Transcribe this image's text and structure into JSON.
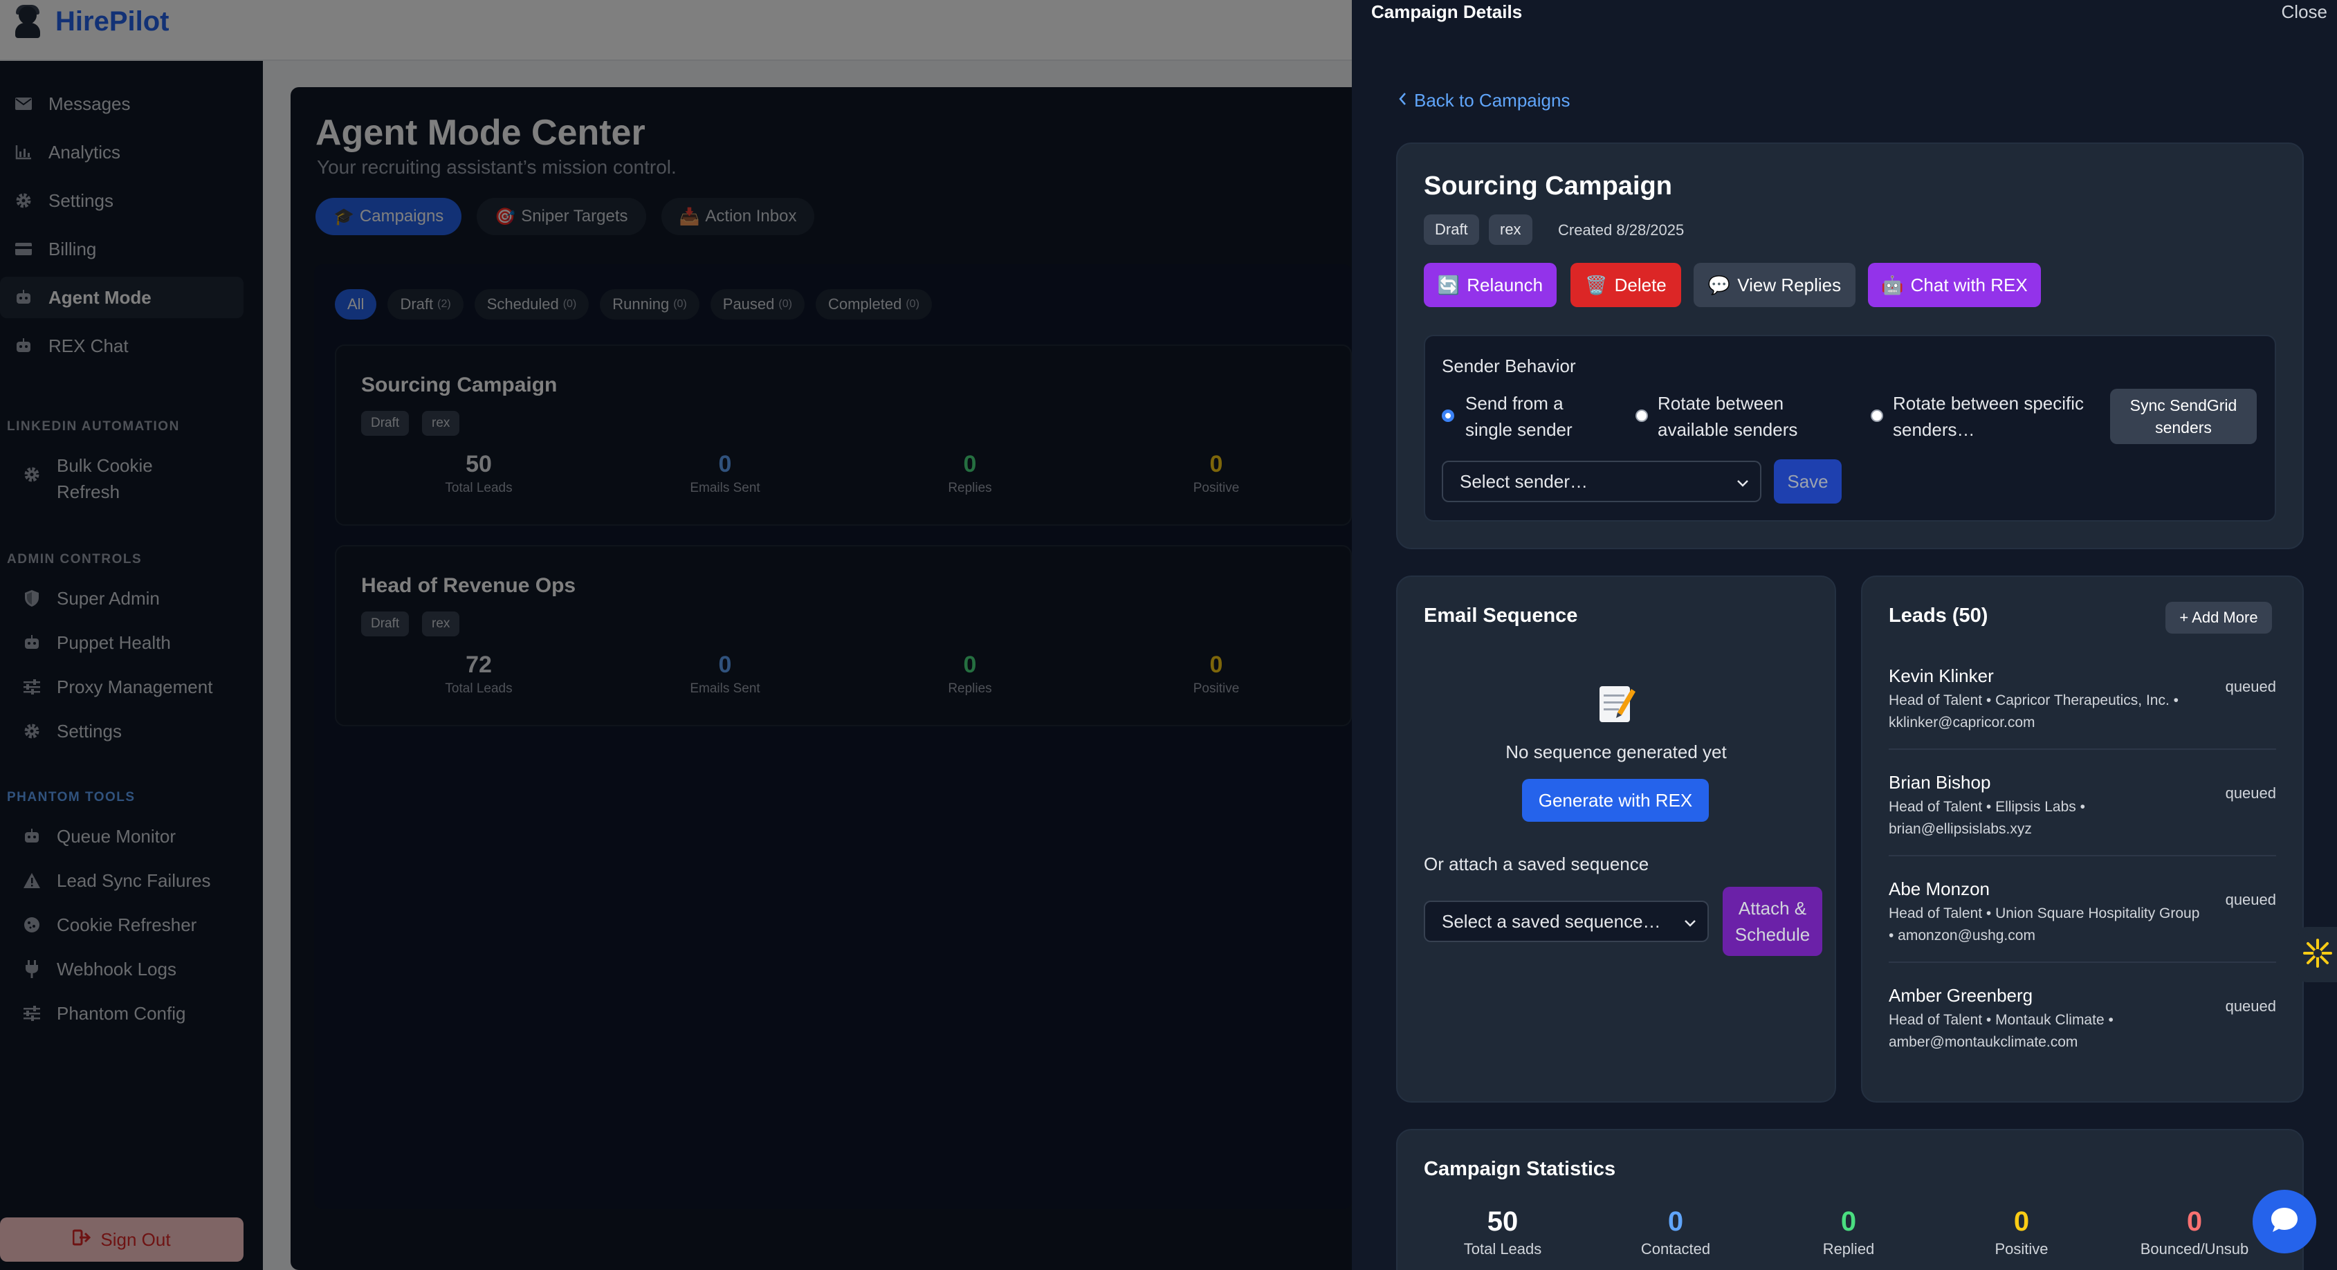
{
  "app": {
    "name": "HirePilot"
  },
  "sidebar": {
    "items": [
      {
        "label": "Messages",
        "icon": "envelope-icon"
      },
      {
        "label": "Analytics",
        "icon": "chart-icon"
      },
      {
        "label": "Settings",
        "icon": "gear-icon"
      },
      {
        "label": "Billing",
        "icon": "credit-card-icon"
      },
      {
        "label": "Agent Mode",
        "icon": "robot-icon"
      },
      {
        "label": "REX Chat",
        "icon": "robot-icon"
      }
    ],
    "linkedin_heading": "LINKEDIN AUTOMATION",
    "linkedin_items": [
      {
        "label_line1": "Bulk Cookie",
        "label_line2": "Refresh",
        "icon": "gear-icon"
      }
    ],
    "admin_heading": "ADMIN CONTROLS",
    "admin_items": [
      {
        "label": "Super Admin",
        "icon": "shield-icon"
      },
      {
        "label": "Puppet Health",
        "icon": "robot-icon"
      },
      {
        "label": "Proxy Management",
        "icon": "sliders-icon"
      },
      {
        "label": "Settings",
        "icon": "gear-icon"
      }
    ],
    "phantom_heading": "PHANTOM TOOLS",
    "phantom_items": [
      {
        "label": "Queue Monitor",
        "icon": "robot-icon"
      },
      {
        "label": "Lead Sync Failures",
        "icon": "warning-icon"
      },
      {
        "label": "Cookie Refresher",
        "icon": "cookie-icon"
      },
      {
        "label": "Webhook Logs",
        "icon": "plug-icon"
      },
      {
        "label": "Phantom Config",
        "icon": "sliders-icon"
      }
    ],
    "signout": "Sign Out"
  },
  "main": {
    "title": "Agent Mode Center",
    "subtitle": "Your recruiting assistant’s mission control.",
    "tabs": [
      {
        "label": "Campaigns",
        "emoji": "🎓"
      },
      {
        "label": "Sniper Targets",
        "emoji": "🎯"
      },
      {
        "label": "Action Inbox",
        "emoji": "📥"
      }
    ],
    "filters": [
      {
        "label": "All",
        "count": ""
      },
      {
        "label": "Draft",
        "count": "(2)"
      },
      {
        "label": "Scheduled",
        "count": "(0)"
      },
      {
        "label": "Running",
        "count": "(0)"
      },
      {
        "label": "Paused",
        "count": "(0)"
      },
      {
        "label": "Completed",
        "count": "(0)"
      }
    ],
    "campaigns": [
      {
        "name": "Sourcing Campaign",
        "status": "Draft",
        "owner": "rex",
        "stats": [
          {
            "num": "50",
            "label": "Total Leads"
          },
          {
            "num": "0",
            "label": "Emails Sent"
          },
          {
            "num": "0",
            "label": "Replies"
          },
          {
            "num": "0",
            "label": "Positive"
          }
        ]
      },
      {
        "name": "Head of Revenue Ops",
        "status": "Draft",
        "owner": "rex",
        "stats": [
          {
            "num": "72",
            "label": "Total Leads"
          },
          {
            "num": "0",
            "label": "Emails Sent"
          },
          {
            "num": "0",
            "label": "Replies"
          },
          {
            "num": "0",
            "label": "Positive"
          }
        ]
      }
    ]
  },
  "drawer": {
    "title": "Campaign Details",
    "close": "Close",
    "back": "Back to Campaigns",
    "campaign_name": "Sourcing Campaign",
    "status": "Draft",
    "owner": "rex",
    "created": "Created 8/28/2025",
    "actions": [
      {
        "label": "Relaunch",
        "emoji": "🔄",
        "color": "#9333ea"
      },
      {
        "label": "Delete",
        "emoji": "🗑️",
        "color": "#dc2626"
      },
      {
        "label": "View Replies",
        "emoji": "💬",
        "color": "#374151"
      },
      {
        "label": "Chat with REX",
        "emoji": "🤖",
        "color": "#9333ea"
      }
    ],
    "sender": {
      "heading": "Sender Behavior",
      "opt1_line1": "Send from a",
      "opt1_line2": "single sender",
      "opt2_line1": "Rotate between",
      "opt2_line2": "available senders",
      "opt3_line1": "Rotate between specific",
      "opt3_line2": "senders…",
      "sync_line1": "Sync SendGrid",
      "sync_line2": "senders",
      "select_placeholder": "Select sender…",
      "save": "Save"
    },
    "sequence": {
      "heading": "Email Sequence",
      "empty": "No sequence generated yet",
      "generate": "Generate with REX",
      "attach_heading": "Or attach a saved sequence",
      "select_placeholder": "Select a saved sequence…",
      "attach_line1": "Attach &",
      "attach_line2": "Schedule"
    },
    "leads": {
      "heading": "Leads (50)",
      "add_more": "+ Add More",
      "items": [
        {
          "name": "Kevin Klinker",
          "line1": "Head of Talent • Capricor Therapeutics, Inc. •",
          "line2": "kklinker@capricor.com",
          "status": "queued"
        },
        {
          "name": "Brian Bishop",
          "line1": "Head of Talent • Ellipsis Labs •",
          "line2": "brian@ellipsislabs.xyz",
          "status": "queued"
        },
        {
          "name": "Abe Monzon",
          "line1": "Head of Talent • Union Square Hospitality Group",
          "line2": "• amonzon@ushg.com",
          "status": "queued"
        },
        {
          "name": "Amber Greenberg",
          "line1": "Head of Talent • Montauk Climate •",
          "line2": "amber@montaukclimate.com",
          "status": "queued"
        }
      ]
    },
    "stats": {
      "heading": "Campaign Statistics",
      "items": [
        {
          "num": "50",
          "label": "Total Leads",
          "color": "#ffffff"
        },
        {
          "num": "0",
          "label": "Contacted",
          "color": "#60a5fa"
        },
        {
          "num": "0",
          "label": "Replied",
          "color": "#4ade80"
        },
        {
          "num": "0",
          "label": "Positive",
          "color": "#facc15"
        },
        {
          "num": "0",
          "label": "Bounced/Unsub",
          "color": "#f87171"
        }
      ]
    }
  }
}
